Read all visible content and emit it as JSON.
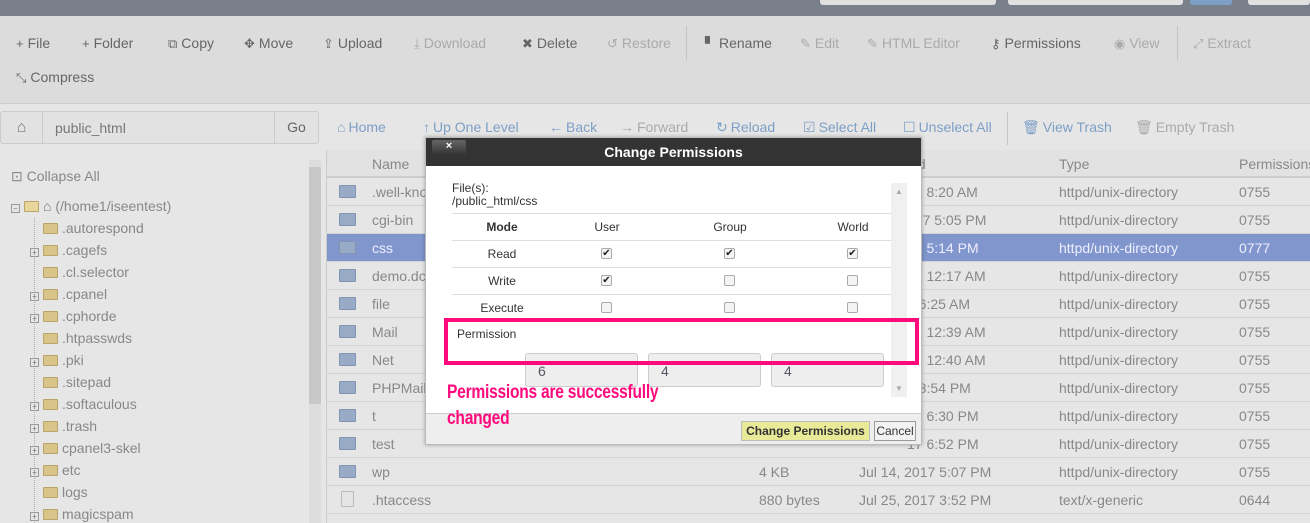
{
  "toolbar": {
    "row1": [
      {
        "label": "File",
        "icon": "+",
        "dis": false
      },
      {
        "label": "Folder",
        "icon": "+",
        "dis": false
      },
      {
        "label": "Copy",
        "icon": "⧉",
        "dis": false
      },
      {
        "label": "Move",
        "icon": "✥",
        "dis": false
      },
      {
        "label": "Upload",
        "icon": "⇪",
        "dis": false
      },
      {
        "label": "Download",
        "icon": "⤓",
        "dis": true
      },
      {
        "label": "Delete",
        "icon": "✖",
        "dis": false
      },
      {
        "label": "Restore",
        "icon": "↺",
        "dis": true
      },
      {
        "label": "Rename",
        "icon": "▘",
        "dis": false
      },
      {
        "label": "Edit",
        "icon": "✎",
        "dis": true
      },
      {
        "label": "HTML Editor",
        "icon": "✎",
        "dis": true
      },
      {
        "label": "Permissions",
        "icon": "⚷",
        "dis": false
      },
      {
        "label": "View",
        "icon": "◉",
        "dis": true
      },
      {
        "label": "Extract",
        "icon": "⤢",
        "dis": true
      }
    ],
    "compress": "Compress",
    "compress_icon": "⤡"
  },
  "path": {
    "value": "public_html",
    "go": "Go"
  },
  "nav": [
    {
      "label": "Home",
      "icon": "⌂"
    },
    {
      "label": "Up One Level",
      "icon": "↑"
    },
    {
      "label": "Back",
      "icon": "←"
    },
    {
      "label": "Forward",
      "icon": "→"
    },
    {
      "label": "Reload",
      "icon": "↻"
    },
    {
      "label": "Select All",
      "icon": "☑"
    },
    {
      "label": "Unselect All",
      "icon": "☐"
    },
    {
      "label": "View Trash",
      "icon": "🗑"
    },
    {
      "label": "Empty Trash",
      "icon": "🗑"
    }
  ],
  "sidebar": {
    "collapse": "Collapse All",
    "root": "(/home1/iseentest)",
    "items": [
      {
        "name": ".autorespond",
        "exp": false
      },
      {
        "name": ".cagefs",
        "exp": true
      },
      {
        "name": ".cl.selector",
        "exp": false
      },
      {
        "name": ".cpanel",
        "exp": true
      },
      {
        "name": ".cphorde",
        "exp": true
      },
      {
        "name": ".htpasswds",
        "exp": false
      },
      {
        "name": ".pki",
        "exp": true
      },
      {
        "name": ".sitepad",
        "exp": false
      },
      {
        "name": ".softaculous",
        "exp": true
      },
      {
        "name": ".trash",
        "exp": true
      },
      {
        "name": "cpanel3-skel",
        "exp": true
      },
      {
        "name": "etc",
        "exp": true
      },
      {
        "name": "logs",
        "exp": false
      },
      {
        "name": "magicspam",
        "exp": true
      }
    ]
  },
  "table": {
    "headers": {
      "name": "Name",
      "modified": "ied",
      "type": "Type",
      "perms": "Permissions"
    },
    "rows": [
      {
        "name": ".well-known",
        "size": "",
        "mod": "17 8:20 AM",
        "type": "httpd/unix-directory",
        "perm": "0755"
      },
      {
        "name": "cgi-bin",
        "size": "",
        "mod": "017 5:05 PM",
        "type": "httpd/unix-directory",
        "perm": "0755"
      },
      {
        "name": "css",
        "size": "",
        "mod": "17 5:14 PM",
        "type": "httpd/unix-directory",
        "perm": "0777",
        "sel": true
      },
      {
        "name": "demo.dc",
        "size": "",
        "mod": "17 12:17 AM",
        "type": "httpd/unix-directory",
        "perm": "0755"
      },
      {
        "name": "file",
        "size": "",
        "mod": "7 6:25 AM",
        "type": "httpd/unix-directory",
        "perm": "0755"
      },
      {
        "name": "Mail",
        "size": "",
        "mod": "17 12:39 AM",
        "type": "httpd/unix-directory",
        "perm": "0755"
      },
      {
        "name": "Net",
        "size": "",
        "mod": "17 12:40 AM",
        "type": "httpd/unix-directory",
        "perm": "0755"
      },
      {
        "name": "PHPMail",
        "size": "",
        "mod": "6 8:54 PM",
        "type": "httpd/unix-directory",
        "perm": "0755"
      },
      {
        "name": "t",
        "size": "",
        "mod": "17 6:30 PM",
        "type": "httpd/unix-directory",
        "perm": "0755"
      },
      {
        "name": "test",
        "size": "",
        "mod": "17 6:52 PM",
        "type": "httpd/unix-directory",
        "perm": "0755"
      },
      {
        "name": "wp",
        "size": "4 KB",
        "mod": "Jul 14, 2017 5:07 PM",
        "type": "httpd/unix-directory",
        "perm": "0755",
        "full": true
      },
      {
        "name": ".htaccess",
        "size": "880 bytes",
        "mod": "Jul 25, 2017 3:52 PM",
        "type": "text/x-generic",
        "perm": "0644",
        "full": true,
        "doc": true
      }
    ]
  },
  "dialog": {
    "title": "Change Permissions",
    "close": "×",
    "files_label": "File(s):",
    "files_path": "/public_html/css",
    "headers": [
      "Mode",
      "User",
      "Group",
      "World"
    ],
    "modes": [
      {
        "label": "Read",
        "vals": [
          true,
          true,
          true
        ]
      },
      {
        "label": "Write",
        "vals": [
          true,
          false,
          false
        ]
      },
      {
        "label": "Execute",
        "vals": [
          false,
          false,
          false
        ]
      }
    ],
    "perm_label": "Permission",
    "perm_values": [
      "6",
      "4",
      "4"
    ],
    "ok": "Change Permissions",
    "cancel": "Cancel"
  },
  "annotation": {
    "text": "Permissions are successfully changed",
    "color": "#ff0a7c"
  },
  "colors": {
    "selected_row": "#8096cc",
    "title_bar": "#333333",
    "ok_button": "#e8ea98"
  }
}
